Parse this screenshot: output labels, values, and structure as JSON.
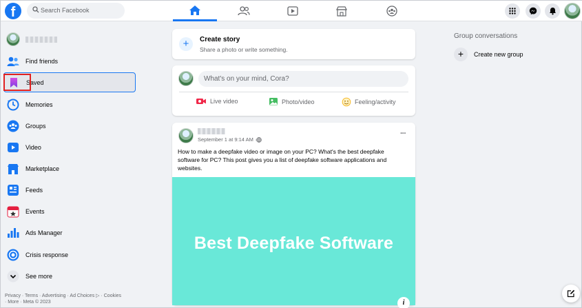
{
  "topbar": {
    "logo_letter": "f",
    "search_placeholder": "Search Facebook",
    "nav_tabs": [
      "home-icon",
      "friends-icon",
      "watch-icon",
      "marketplace-icon",
      "groups-icon"
    ],
    "active_tab": "home-icon"
  },
  "sidebar": {
    "items": [
      {
        "label": "Find friends",
        "icon": "find-friends-icon"
      },
      {
        "label": "Saved",
        "icon": "saved-bookmark-icon"
      },
      {
        "label": "Memories",
        "icon": "memories-clock-icon"
      },
      {
        "label": "Groups",
        "icon": "groups-icon"
      },
      {
        "label": "Video",
        "icon": "video-icon"
      },
      {
        "label": "Marketplace",
        "icon": "marketplace-icon"
      },
      {
        "label": "Feeds",
        "icon": "feeds-icon"
      },
      {
        "label": "Events",
        "icon": "events-icon"
      },
      {
        "label": "Ads Manager",
        "icon": "ads-manager-icon"
      },
      {
        "label": "Crisis response",
        "icon": "crisis-response-icon"
      },
      {
        "label": "See more",
        "icon": "chevron-down-icon"
      }
    ],
    "footer_line1": "Privacy · Terms · Advertising · Ad Choices ▷ · Cookies",
    "footer_line2": "· More · Meta © 2023"
  },
  "story": {
    "title": "Create story",
    "subtitle": "Share a photo or write something."
  },
  "composer": {
    "placeholder": "What's on your mind, Cora?",
    "actions": [
      "Live video",
      "Photo/video",
      "Feeling/activity"
    ]
  },
  "post": {
    "timestamp": "September 1 at 9:14 AM · ",
    "text": "How to make a deepfake video or image on your PC? What's the best deepfake software for PC? This post gives you a list of deepfake software applications and websites.",
    "image_headline": "Best Deepfake Software",
    "more_menu": "···",
    "info_label": "i"
  },
  "right": {
    "group_conversations_title": "Group conversations",
    "create_new_group": "Create new group"
  },
  "colors": {
    "brand": "#1877f2",
    "post_image_bg": "#69e8d8",
    "highlight_box": "#e02020"
  }
}
